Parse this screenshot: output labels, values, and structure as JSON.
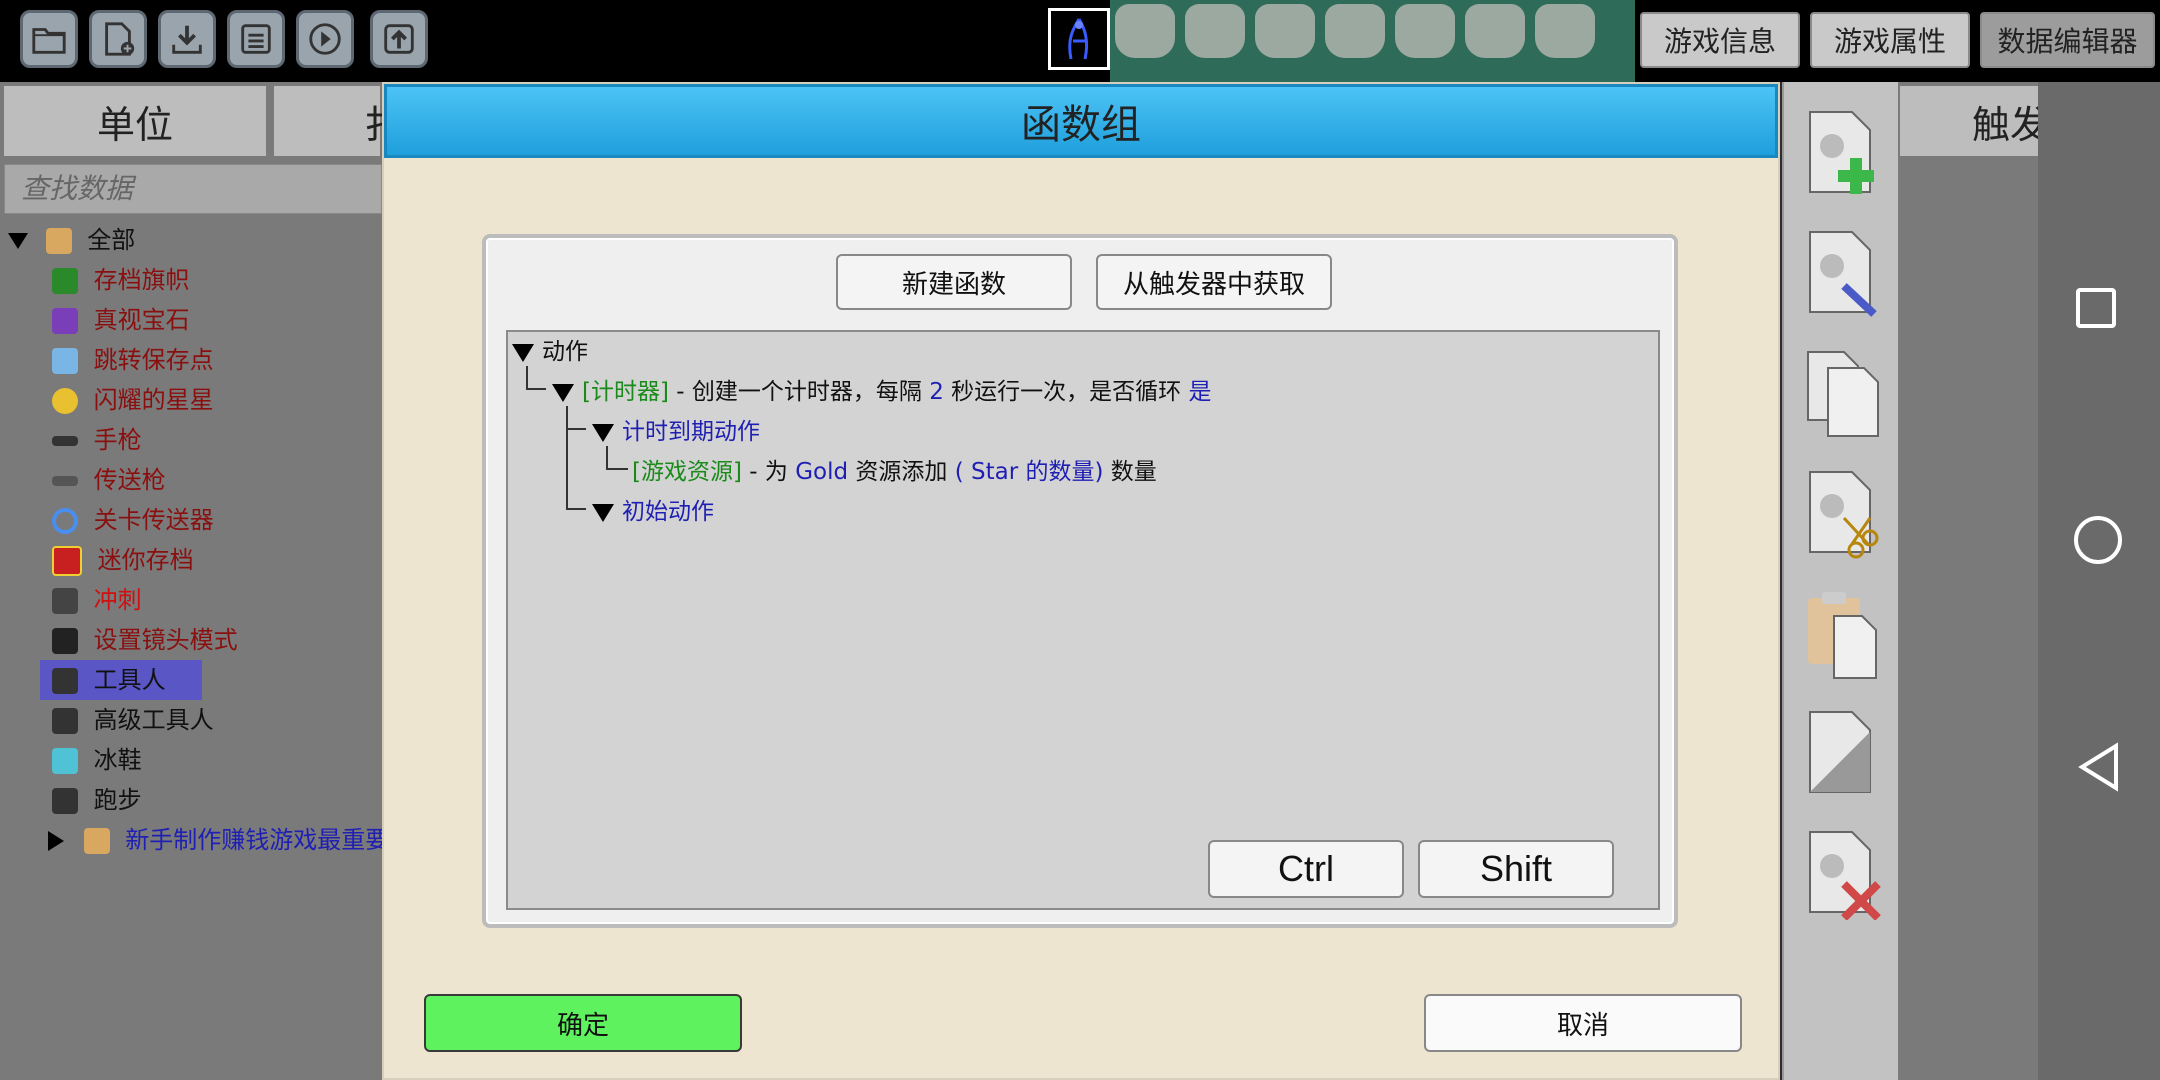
{
  "toolbar": {
    "icons": [
      "folder-icon",
      "new-file-icon",
      "download-icon",
      "save-icon",
      "play-icon",
      "upload-icon"
    ],
    "right_buttons": [
      "游戏信息",
      "游戏属性",
      "数据编辑器"
    ]
  },
  "left_panel": {
    "tabs": [
      "单位",
      "扌"
    ],
    "search_placeholder": "查找数据",
    "tree": [
      {
        "label": "全部",
        "color": "#111111",
        "icon": "folder-icon"
      },
      {
        "label": "存档旗帜",
        "color": "#8a1010",
        "icon": "flag-icon"
      },
      {
        "label": "真视宝石",
        "color": "#8a1010",
        "icon": "gem-icon"
      },
      {
        "label": "跳转保存点",
        "color": "#8a1010",
        "icon": "arrow-up-icon"
      },
      {
        "label": "闪耀的星星",
        "color": "#8a1010",
        "icon": "star-icon"
      },
      {
        "label": "手枪",
        "color": "#8a1010",
        "icon": "pistol-icon"
      },
      {
        "label": "传送枪",
        "color": "#8a1010",
        "icon": "portal-gun-icon"
      },
      {
        "label": "关卡传送器",
        "color": "#8a1010",
        "icon": "portal-ring-icon"
      },
      {
        "label": "迷你存档",
        "color": "#8a1010",
        "icon": "mini-save-icon"
      },
      {
        "label": "冲刺",
        "color": "#d01010",
        "icon": "dash-icon"
      },
      {
        "label": "设置镜头模式",
        "color": "#8a1010",
        "icon": "camera-icon"
      },
      {
        "label": "工具人",
        "color": "#111111",
        "icon": "character-icon"
      },
      {
        "label": "高级工具人",
        "color": "#111111",
        "icon": "character-icon"
      },
      {
        "label": "冰鞋",
        "color": "#111111",
        "icon": "ice-skate-icon"
      },
      {
        "label": "跑步",
        "color": "#111111",
        "icon": "runner-icon"
      },
      {
        "label": "新手制作赚钱游戏最重要",
        "color": "#1f1fb4",
        "icon": "folder-icon"
      }
    ]
  },
  "right_panel": {
    "tab": "触发器",
    "side_icons": [
      "add-file-icon",
      "edit-file-icon",
      "copy-file-icon",
      "cut-file-icon",
      "paste-icon",
      "blank-file-icon",
      "delete-file-icon"
    ]
  },
  "dialog": {
    "title": "函数组",
    "buttons": {
      "new_function": "新建函数",
      "from_trigger": "从触发器中获取",
      "ctrl": "Ctrl",
      "shift": "Shift",
      "ok": "确定",
      "cancel": "取消"
    },
    "tree": {
      "root": "动作",
      "timer_tag": "[计时器]",
      "timer_text_a": " - 创建一个计时器，每隔 ",
      "timer_interval": "2",
      "timer_text_b": " 秒运行一次，是否循环 ",
      "timer_loop": "是",
      "expire_label": "计时到期动作",
      "res_tag": "[游戏资源]",
      "res_text_a": " - 为 ",
      "res_name": "Gold",
      "res_text_b": " 资源添加 ",
      "res_amount": "( Star 的数量)",
      "res_text_c": " 数量",
      "init_label": "初始动作"
    }
  },
  "colors": {
    "dialog_title": "#1f9fdc",
    "ok_button": "#5ef25e",
    "selected_item": "#5a56c6"
  }
}
